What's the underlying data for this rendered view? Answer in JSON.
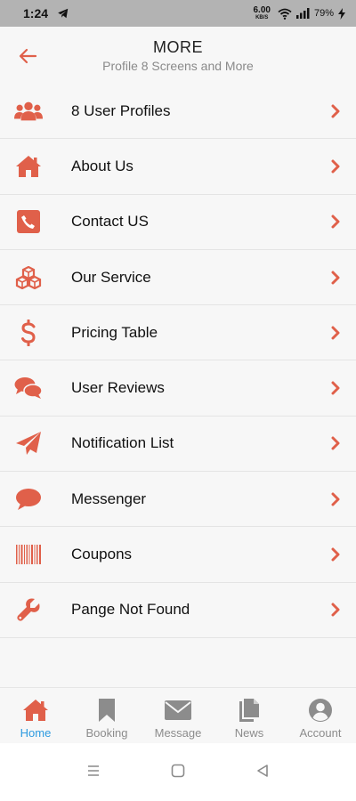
{
  "status": {
    "time": "1:24",
    "net_speed_value": "6.00",
    "net_speed_unit": "KB/S",
    "battery": "79%"
  },
  "header": {
    "title": "MORE",
    "subtitle": "Profile 8 Screens and More"
  },
  "menu": {
    "items": [
      {
        "label": "8 User Profiles",
        "icon": "users-icon"
      },
      {
        "label": "About Us",
        "icon": "home-icon"
      },
      {
        "label": "Contact US",
        "icon": "phone-icon"
      },
      {
        "label": "Our Service",
        "icon": "cubes-icon"
      },
      {
        "label": "Pricing Table",
        "icon": "dollar-icon"
      },
      {
        "label": "User Reviews",
        "icon": "comments-icon"
      },
      {
        "label": "Notification List",
        "icon": "paper-plane-icon"
      },
      {
        "label": "Messenger",
        "icon": "chat-bubble-icon"
      },
      {
        "label": "Coupons",
        "icon": "barcode-icon"
      },
      {
        "label": "Pange Not Found",
        "icon": "wrench-icon"
      }
    ]
  },
  "tabbar": {
    "tabs": [
      {
        "label": "Home",
        "icon": "home-icon",
        "active": true
      },
      {
        "label": "Booking",
        "icon": "bookmark-icon",
        "active": false
      },
      {
        "label": "Message",
        "icon": "envelope-icon",
        "active": false
      },
      {
        "label": "News",
        "icon": "documents-icon",
        "active": false
      },
      {
        "label": "Account",
        "icon": "user-circle-icon",
        "active": false
      }
    ]
  },
  "colors": {
    "accent": "#e0604a",
    "active_tab": "#2e9be0",
    "inactive_tab": "#8c8c8c",
    "status_bar": "#b3b3b3"
  }
}
